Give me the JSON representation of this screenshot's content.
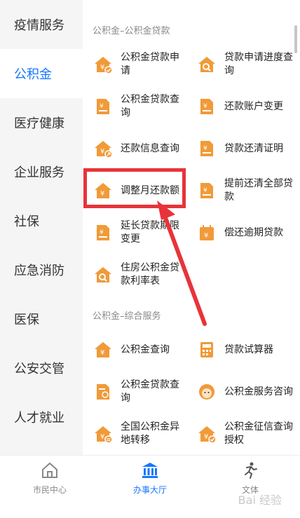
{
  "sidebar": {
    "items": [
      {
        "label": "疫情服务"
      },
      {
        "label": "公积金"
      },
      {
        "label": "医疗健康"
      },
      {
        "label": "企业服务"
      },
      {
        "label": "社保"
      },
      {
        "label": "应急消防"
      },
      {
        "label": "医保"
      },
      {
        "label": "公安交管"
      },
      {
        "label": "人才就业"
      }
    ],
    "active_index": 1
  },
  "section1": {
    "title": "公积金–公积金贷款",
    "items": [
      {
        "label": "公积金贷款申请",
        "icon": "house-check-icon"
      },
      {
        "label": "贷款申请进度查询",
        "icon": "house-search-icon"
      },
      {
        "label": "公积金贷款查询",
        "icon": "document-yen-icon"
      },
      {
        "label": "还款账户变更",
        "icon": "document-yen-icon"
      },
      {
        "label": "还款信息查询",
        "icon": "house-arrow-icon"
      },
      {
        "label": "贷款还清证明",
        "icon": "document-yen-icon"
      },
      {
        "label": "调整月还款额",
        "icon": "house-yen-icon"
      },
      {
        "label": "提前还清全部贷款",
        "icon": "document-yen-icon"
      },
      {
        "label": "延长贷款期限变更",
        "icon": "document-yen-icon"
      },
      {
        "label": "偿还逾期贷款",
        "icon": "calendar-yen-icon"
      },
      {
        "label": "住房公积金贷款利率表",
        "icon": "house-search-icon"
      }
    ]
  },
  "section2": {
    "title": "公积金–综合服务",
    "items": [
      {
        "label": "公积金查询",
        "icon": "house-yen-icon"
      },
      {
        "label": "贷款试算器",
        "icon": "calculator-icon"
      },
      {
        "label": "公积金贷款查询",
        "icon": "document-search-icon"
      },
      {
        "label": "公积金服务咨询",
        "icon": "service-agent-icon"
      },
      {
        "label": "全国公积金异地转移",
        "icon": "house-transfer-icon"
      },
      {
        "label": "公积金征信查询授权",
        "icon": "house-check-icon"
      }
    ]
  },
  "tabbar": {
    "items": [
      {
        "label": "市民中心",
        "icon": "home-icon"
      },
      {
        "label": "办事大厅",
        "icon": "hall-icon"
      },
      {
        "label": "文体",
        "icon": "runner-icon"
      }
    ],
    "active_index": 1
  },
  "colors": {
    "accent": "#1677ff",
    "icon": "#f19a38",
    "highlight": "#e8333a"
  }
}
